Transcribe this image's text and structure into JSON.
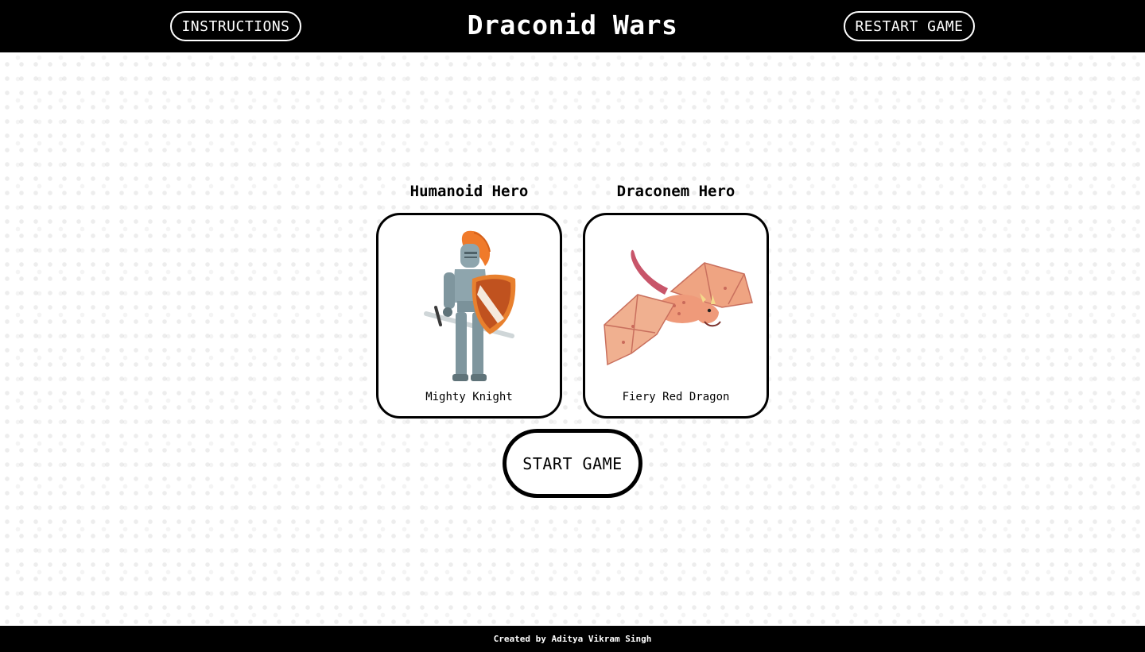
{
  "header": {
    "instructions_label": "INSTRUCTIONS",
    "title": "Draconid Wars",
    "restart_label": "RESTART GAME"
  },
  "heroes": [
    {
      "category": "Humanoid Hero",
      "name": "Mighty Knight",
      "icon": "knight-icon"
    },
    {
      "category": "Draconem Hero",
      "name": "Fiery Red Dragon",
      "icon": "dragon-icon"
    }
  ],
  "start_label": "START GAME",
  "footer": {
    "credit": "Created by Aditya Vikram Singh"
  },
  "colors": {
    "header_bg": "#000000",
    "knight_plume": "#f07a2a",
    "knight_armor": "#8ea5ad",
    "shield_red": "#c0521f",
    "dragon_body": "#ef9a7a"
  }
}
